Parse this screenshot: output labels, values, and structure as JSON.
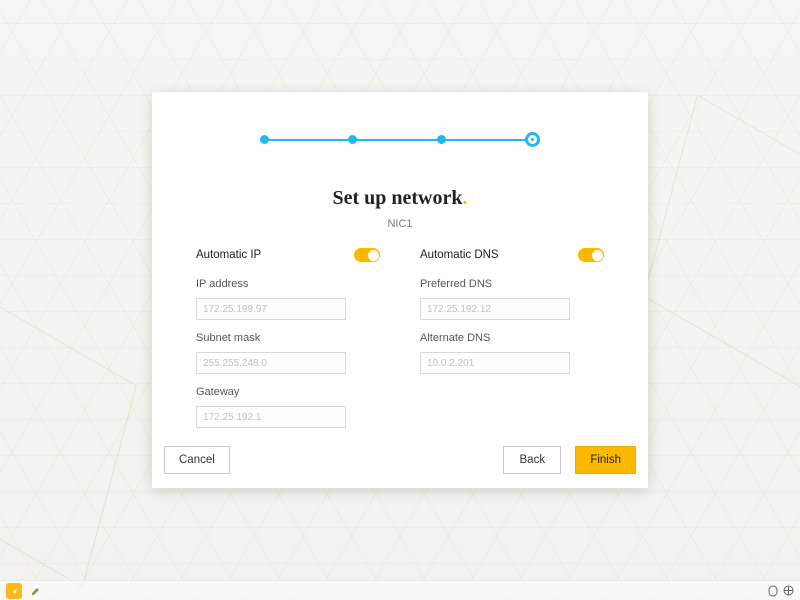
{
  "stepper": {
    "steps": 4,
    "current": 4
  },
  "title": "Set up network",
  "subtitle": "NIC1",
  "left": {
    "toggle_label": "Automatic IP",
    "toggle_on": true,
    "fields": [
      {
        "label": "IP address",
        "value": "172.25.199.97"
      },
      {
        "label": "Subnet mask",
        "value": "255.255.248.0"
      },
      {
        "label": "Gateway",
        "value": "172.25.192.1"
      }
    ]
  },
  "right": {
    "toggle_label": "Automatic DNS",
    "toggle_on": true,
    "fields": [
      {
        "label": "Preferred DNS",
        "value": "172.25.192.12"
      },
      {
        "label": "Alternate DNS",
        "value": "10.0.2.201"
      }
    ]
  },
  "buttons": {
    "cancel": "Cancel",
    "back": "Back",
    "finish": "Finish"
  },
  "colors": {
    "accent": "#fcb900",
    "step": "#21b8f0"
  }
}
